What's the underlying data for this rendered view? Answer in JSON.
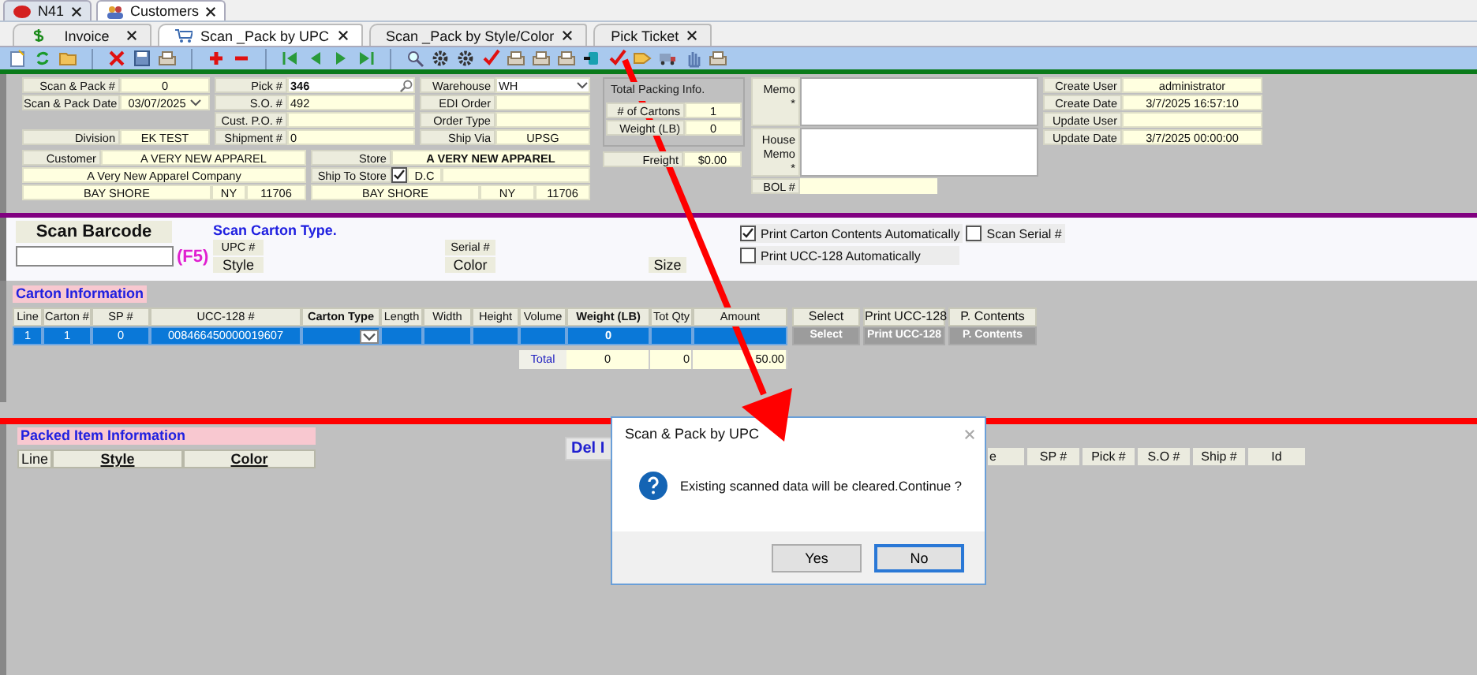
{
  "app_tabs": [
    {
      "label": "N41",
      "selected": false
    },
    {
      "label": "Customers",
      "selected": true
    }
  ],
  "screen_tabs": [
    {
      "label": "Invoice",
      "selected": false
    },
    {
      "label": "Scan _Pack by UPC",
      "selected": true
    },
    {
      "label": "Scan _Pack by Style/Color",
      "selected": false
    },
    {
      "label": "Pick Ticket",
      "selected": false
    }
  ],
  "order_columns": [
    [
      {
        "kind": "text",
        "label": "Scan & Pack #",
        "value": "0"
      },
      {
        "kind": "date",
        "label": "Scan & Pack Date",
        "value": "03/07/2025"
      },
      {
        "kind": "blank"
      },
      {
        "kind": "text",
        "label": "Division",
        "value": "EK TEST"
      }
    ],
    [
      {
        "kind": "lookup",
        "label": "Pick #",
        "value": "346"
      },
      {
        "kind": "text",
        "label": "S.O. #",
        "value": "492"
      },
      {
        "kind": "text",
        "label": "Cust. P.O. #"
      },
      {
        "kind": "text",
        "label": "Shipment #",
        "value": "0"
      }
    ],
    [
      {
        "kind": "select",
        "label": "Warehouse",
        "value": "WH"
      },
      {
        "kind": "text",
        "label": "EDI Order"
      },
      {
        "kind": "text",
        "label": "Order Type"
      },
      {
        "kind": "text",
        "label": "Ship Via",
        "value": "UPSG"
      }
    ]
  ],
  "customer": {
    "label": "Customer",
    "name": "A VERY NEW APPAREL",
    "company": "A Very New Apparel Company",
    "city": "BAY SHORE",
    "state": "NY",
    "zip": "11706"
  },
  "store": {
    "label": "Store",
    "name": "A VERY NEW APPAREL",
    "ship_to_label": "Ship To Store",
    "ship_to_checked": true,
    "ship_to_value": "D.C",
    "city": "BAY SHORE",
    "state": "NY",
    "zip": "11706"
  },
  "packing_info": {
    "title": "Total Packing Info.",
    "rows": [
      {
        "label": "# of Cartons",
        "value": "1"
      },
      {
        "label": "Weight (LB)",
        "value": "0"
      }
    ],
    "freight": {
      "label": "Freight",
      "value": "$0.00"
    }
  },
  "memos": [
    {
      "label": "Memo *"
    },
    {
      "label": "House Memo *"
    }
  ],
  "bol": {
    "label": "BOL #"
  },
  "audit": [
    {
      "label": "Create User",
      "value": "administrator"
    },
    {
      "label": "Create Date",
      "value": "3/7/2025 16:57:10"
    },
    {
      "label": "Update User"
    },
    {
      "label": "Update Date",
      "value": "3/7/2025 00:00:00"
    }
  ],
  "scan": {
    "title": "Scan Barcode",
    "hotkey": "(F5)",
    "carton_type_title": "Scan Carton Type.",
    "upc_label": "UPC #",
    "style_label": "Style",
    "serial_label": "Serial #",
    "color_label": "Color",
    "size_label": "Size",
    "options": [
      {
        "label": "Print Carton Contents Automatically",
        "checked": true
      },
      {
        "label": "Scan Serial #",
        "checked": false
      },
      {
        "label": "Print UCC-128 Automatically",
        "checked": false
      }
    ]
  },
  "carton": {
    "title": "Carton Information",
    "columns": [
      {
        "label": "Line",
        "bold": false,
        "kind": "text"
      },
      {
        "label": "Carton #",
        "bold": false,
        "kind": "text"
      },
      {
        "label": "SP #",
        "bold": false,
        "kind": "text"
      },
      {
        "label": "UCC-128 #",
        "bold": false,
        "kind": "text"
      },
      {
        "label": "Carton Type",
        "bold": true,
        "kind": "select"
      },
      {
        "label": "Length",
        "bold": false,
        "kind": "text"
      },
      {
        "label": "Width",
        "bold": false,
        "kind": "text"
      },
      {
        "label": "Height",
        "bold": false,
        "kind": "text"
      },
      {
        "label": "Volume",
        "bold": false,
        "kind": "text"
      },
      {
        "label": "Weight (LB)",
        "bold": true,
        "kind": "text"
      },
      {
        "label": "Tot Qty",
        "bold": false,
        "kind": "text"
      },
      {
        "label": "Amount",
        "bold": false,
        "kind": "text"
      }
    ],
    "actions": [
      {
        "label": "Select",
        "row_label": "Select"
      },
      {
        "label": "Print UCC-128",
        "row_label": "Print UCC-128"
      },
      {
        "label": "P. Contents",
        "row_label": "P. Contents"
      }
    ],
    "rows": [
      {
        "selected": true,
        "buttons_disabled": true,
        "cells": [
          "1",
          "1",
          "0",
          "008466450000019607",
          null,
          null,
          null,
          null,
          null,
          "0",
          null,
          null
        ]
      }
    ],
    "totals": {
      "label": "Total",
      "weight": "0",
      "qty": "0",
      "amount": "50.00"
    }
  },
  "packed": {
    "title": "Packed Item Information",
    "columns": [
      {
        "label": "Line",
        "bold": false
      },
      {
        "label": "Style",
        "bold": true
      },
      {
        "label": "Color",
        "bold": true
      }
    ],
    "delete_button": "Del I",
    "right_columns": [
      "e",
      "SP #",
      "Pick #",
      "S.O #",
      "Ship #",
      "Id"
    ]
  },
  "dialog": {
    "title": "Scan & Pack by UPC",
    "message": "Existing scanned data will be cleared.Continue ?",
    "buttons": [
      {
        "label": "Yes",
        "selected": false
      },
      {
        "label": "No",
        "selected": true
      }
    ]
  }
}
